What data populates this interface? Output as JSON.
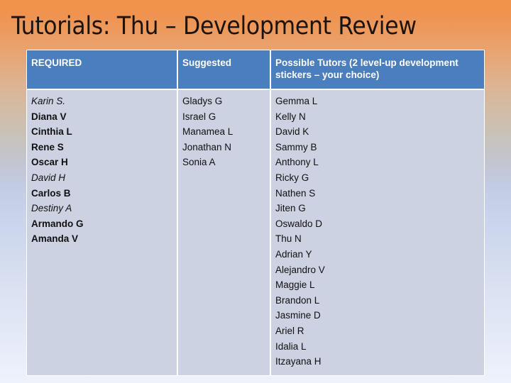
{
  "slide": {
    "title": "Tutorials: Thu – Development Review",
    "background": {
      "top_color": "#f3934a",
      "mid_color": "#c3c4cc",
      "bottom_color": "#eef2fb"
    }
  },
  "table": {
    "header_bg": "#4a7ebc",
    "header_text_color": "#ffffff",
    "body_bg": "#ccd2e1",
    "grid_color": "#ffffff",
    "headers": [
      "REQUIRED",
      "Suggested",
      "Possible Tutors (2 level-up development stickers – your choice)"
    ],
    "columns": [
      {
        "key": "required",
        "header": "REQUIRED",
        "names": [
          {
            "text": "Karin S.",
            "style": "italic"
          },
          {
            "text": "Diana V",
            "style": "bold"
          },
          {
            "text": "Cinthia L",
            "style": "bold"
          },
          {
            "text": "Rene S",
            "style": "bold"
          },
          {
            "text": "Oscar H",
            "style": "bold"
          },
          {
            "text": "David H",
            "style": "italic"
          },
          {
            "text": "Carlos B",
            "style": "bold"
          },
          {
            "text": "Destiny A",
            "style": "italic"
          },
          {
            "text": "Armando G",
            "style": "bold"
          },
          {
            "text": "Amanda V",
            "style": "bold"
          }
        ]
      },
      {
        "key": "suggested",
        "header": "Suggested",
        "names": [
          {
            "text": "Gladys G",
            "style": "normal"
          },
          {
            "text": "Israel G",
            "style": "normal"
          },
          {
            "text": "Manamea L",
            "style": "normal"
          },
          {
            "text": "Jonathan N",
            "style": "normal"
          },
          {
            "text": "Sonia A",
            "style": "normal"
          }
        ]
      },
      {
        "key": "possible_tutors",
        "header": "Possible Tutors (2 level-up development stickers – your choice)",
        "names": [
          {
            "text": "Gemma L",
            "style": "normal"
          },
          {
            "text": "Kelly N",
            "style": "normal"
          },
          {
            "text": "David K",
            "style": "normal"
          },
          {
            "text": "Sammy B",
            "style": "normal"
          },
          {
            "text": "Anthony L",
            "style": "normal"
          },
          {
            "text": "Ricky G",
            "style": "normal"
          },
          {
            "text": "Nathen S",
            "style": "normal"
          },
          {
            "text": "Jiten G",
            "style": "normal"
          },
          {
            "text": "Oswaldo D",
            "style": "normal"
          },
          {
            "text": "Thu N",
            "style": "normal"
          },
          {
            "text": "Adrian Y",
            "style": "normal"
          },
          {
            "text": "Alejandro V",
            "style": "normal"
          },
          {
            "text": "Maggie L",
            "style": "normal"
          },
          {
            "text": "Brandon L",
            "style": "normal"
          },
          {
            "text": "Jasmine D",
            "style": "normal"
          },
          {
            "text": "Ariel R",
            "style": "normal"
          },
          {
            "text": "Idalia L",
            "style": "normal"
          },
          {
            "text": "Itzayana H",
            "style": "normal"
          }
        ]
      }
    ]
  }
}
